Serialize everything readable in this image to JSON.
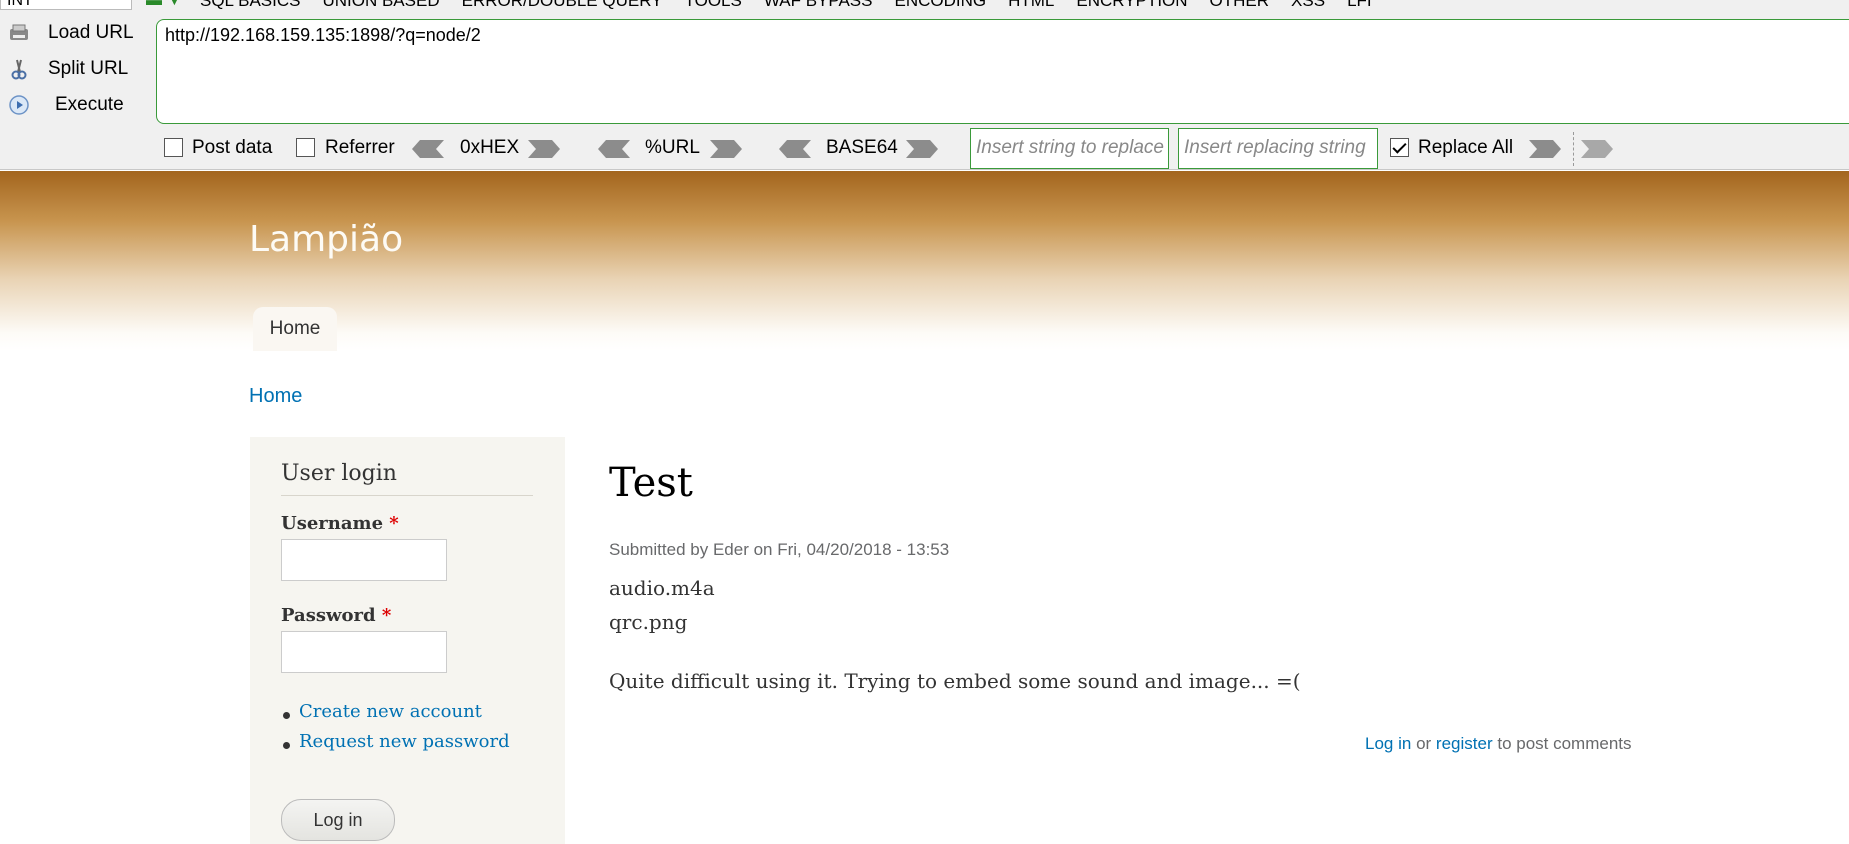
{
  "hackbar": {
    "selector_value": "INT",
    "menus": [
      "SQL BASICS",
      "UNION BASED",
      "ERROR/DOUBLE QUERY",
      "TOOLS",
      "WAF BYPASS",
      "ENCODING",
      "HTML",
      "ENCRYPTION",
      "OTHER",
      "XSS",
      "LFI"
    ],
    "buttons": {
      "load_url": "Load URL",
      "split_url": "Split URL",
      "execute": "Execute"
    },
    "url_value": "http://192.168.159.135:1898/?q=node/2",
    "options": {
      "post_data": "Post data",
      "post_data_checked": false,
      "referrer": "Referrer",
      "referrer_checked": false,
      "hex": "0xHEX",
      "url_enc": "%URL",
      "base64": "BASE64",
      "replace_placeholder": "Insert string to replace",
      "replacing_placeholder": "Insert replacing string",
      "replace_all": "Replace All",
      "replace_all_checked": true
    },
    "accent_color": "#3a9a3a"
  },
  "site": {
    "name": "Lampião",
    "nav": {
      "home": "Home"
    },
    "breadcrumb": "Home",
    "link_color": "#0071b3"
  },
  "login_block": {
    "title": "User login",
    "username_label": "Username",
    "password_label": "Password",
    "required_mark": "*",
    "create_account": "Create new account",
    "request_password": "Request new password",
    "login_button": "Log in"
  },
  "node": {
    "title": "Test",
    "meta": "Submitted by Eder on Fri, 04/20/2018 - 13:53",
    "files": [
      "audio.m4a",
      "qrc.png"
    ],
    "body": "Quite difficult using it. Trying to embed some sound and image... =(",
    "links": {
      "login": "Log in",
      "or": "or",
      "register": "register",
      "suffix": "to post comments"
    }
  }
}
